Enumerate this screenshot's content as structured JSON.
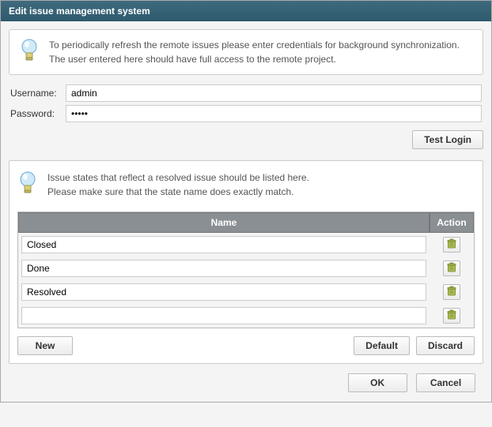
{
  "window": {
    "title": "Edit issue management system"
  },
  "info1": {
    "line1": "To periodically refresh the remote issues please enter credentials for background synchronization.",
    "line2": "The user entered here should have full access to the remote project."
  },
  "fields": {
    "username_label": "Username:",
    "username_value": "admin",
    "password_label": "Password:",
    "password_value": "•••••"
  },
  "buttons": {
    "test_login": "Test Login",
    "new": "New",
    "default": "Default",
    "discard": "Discard",
    "ok": "OK",
    "cancel": "Cancel"
  },
  "info2": {
    "line1": "Issue states that reflect a resolved issue should be listed here.",
    "line2": "Please make sure that the state name does exactly match."
  },
  "table": {
    "col_name": "Name",
    "col_action": "Action",
    "rows": [
      {
        "name": "Closed"
      },
      {
        "name": "Done"
      },
      {
        "name": "Resolved"
      },
      {
        "name": ""
      }
    ]
  }
}
